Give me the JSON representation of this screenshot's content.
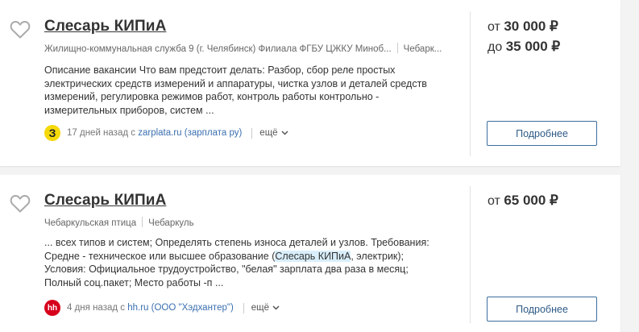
{
  "vacancies": [
    {
      "title": "Слесарь КИПиА",
      "employer": "Жилищно-коммунальная служба 9 (г. Челябинск) Филиала ФГБУ ЦЖКУ Миноб...",
      "city": "Чебарк...",
      "description": "Описание вакансии Что вам предстоит делать: Разбор, сбор реле простых электрических средств измерений и аппаратуры, чистка узлов и деталей средств измерений, регулировка режимов работ, контроль работы контрольно - измерительных приборов, систем ...",
      "salary_from_prefix": "от",
      "salary_from": "30 000 ₽",
      "salary_to_prefix": "до",
      "salary_to": "35 000 ₽",
      "source_icon_text": "З",
      "source_icon_bg": "#f5d90a",
      "source_icon_color": "#222222",
      "posted_ago": "17 дней назад с",
      "source_link": "zarplata.ru (зарплата ру)",
      "more_label": "ещё",
      "details_button": "Подробнее"
    },
    {
      "title": "Слесарь КИПиА",
      "employer": "Чебаркульская птица",
      "city": "Чебаркуль",
      "description_part1": "... всех типов и систем; Определять степень износа деталей и узлов. Требования: Средне - техническое или высшее образование (",
      "description_highlight": "Слесарь КИПиА",
      "description_part2": ", электрик); Условия: Официальное трудоустройство, \"белая\" зарплата два раза в месяц; Полный соц.пакет; Место работы -п ...",
      "salary_prefix": "от",
      "salary": "65 000 ₽",
      "source_icon_text": "hh",
      "source_icon_bg": "#d6001c",
      "source_icon_color": "#ffffff",
      "posted_ago": "4 дня назад с",
      "source_link": "hh.ru (ООО \"Хэдхантер\")",
      "more_label": "ещё",
      "details_button": "Подробнее"
    }
  ]
}
